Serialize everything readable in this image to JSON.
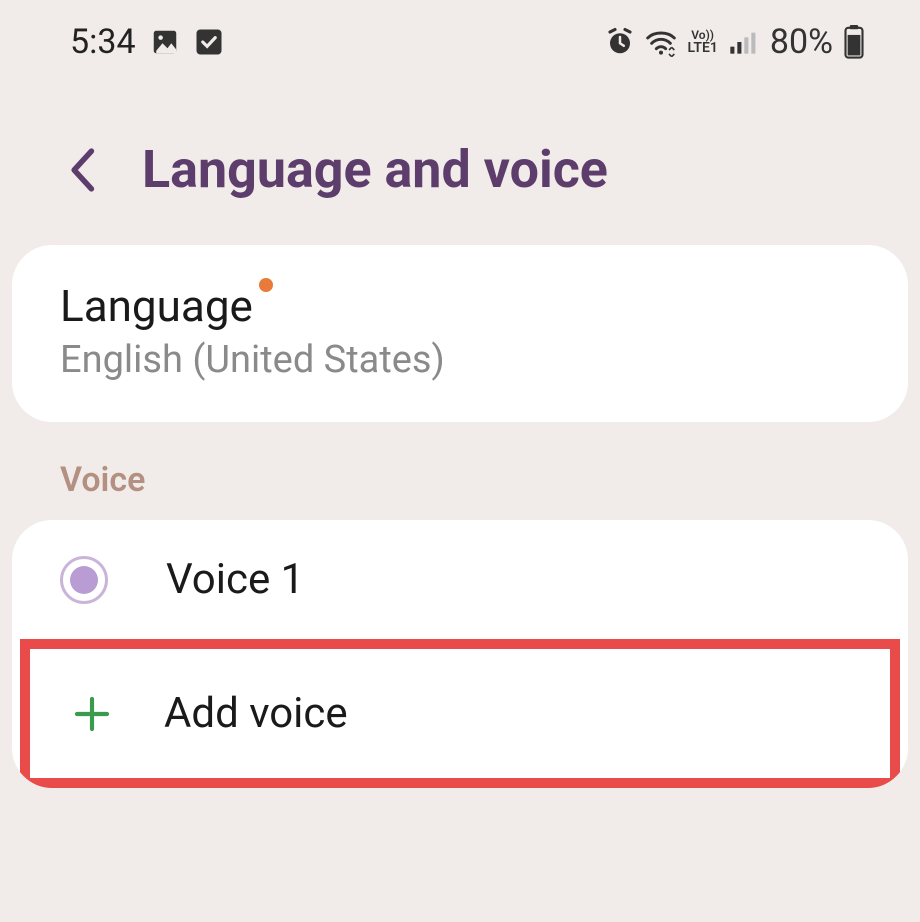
{
  "status": {
    "time": "5:34",
    "battery": "80%",
    "lte": "LTE1",
    "vo": "Vo))"
  },
  "header": {
    "title": "Language and voice"
  },
  "language": {
    "label": "Language",
    "value": "English (United States)"
  },
  "voice_section": {
    "label": "Voice",
    "items": [
      {
        "label": "Voice 1",
        "selected": true
      }
    ],
    "add_label": "Add voice"
  }
}
